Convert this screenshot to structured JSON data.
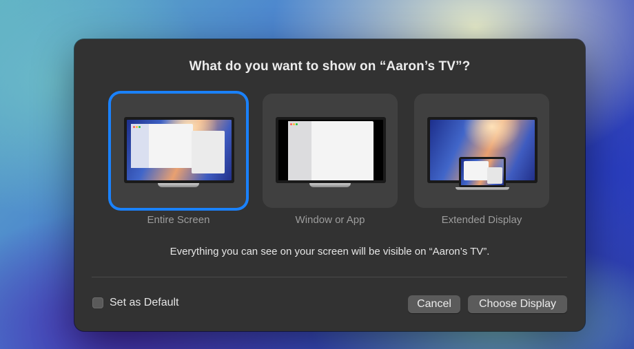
{
  "dialog": {
    "title": "What do you want to show on “Aaron’s TV”?",
    "options": [
      {
        "label": "Entire Screen",
        "selected": true
      },
      {
        "label": "Window or App",
        "selected": false
      },
      {
        "label": "Extended Display",
        "selected": false
      }
    ],
    "description": "Everything you can see on your screen will be visible on “Aaron’s TV”.",
    "set_default_label": "Set as Default",
    "set_default_checked": false,
    "cancel_label": "Cancel",
    "choose_label": "Choose Display"
  },
  "colors": {
    "accent": "#1a82ff",
    "dialog_bg": "#323232",
    "option_bg": "#404040"
  }
}
